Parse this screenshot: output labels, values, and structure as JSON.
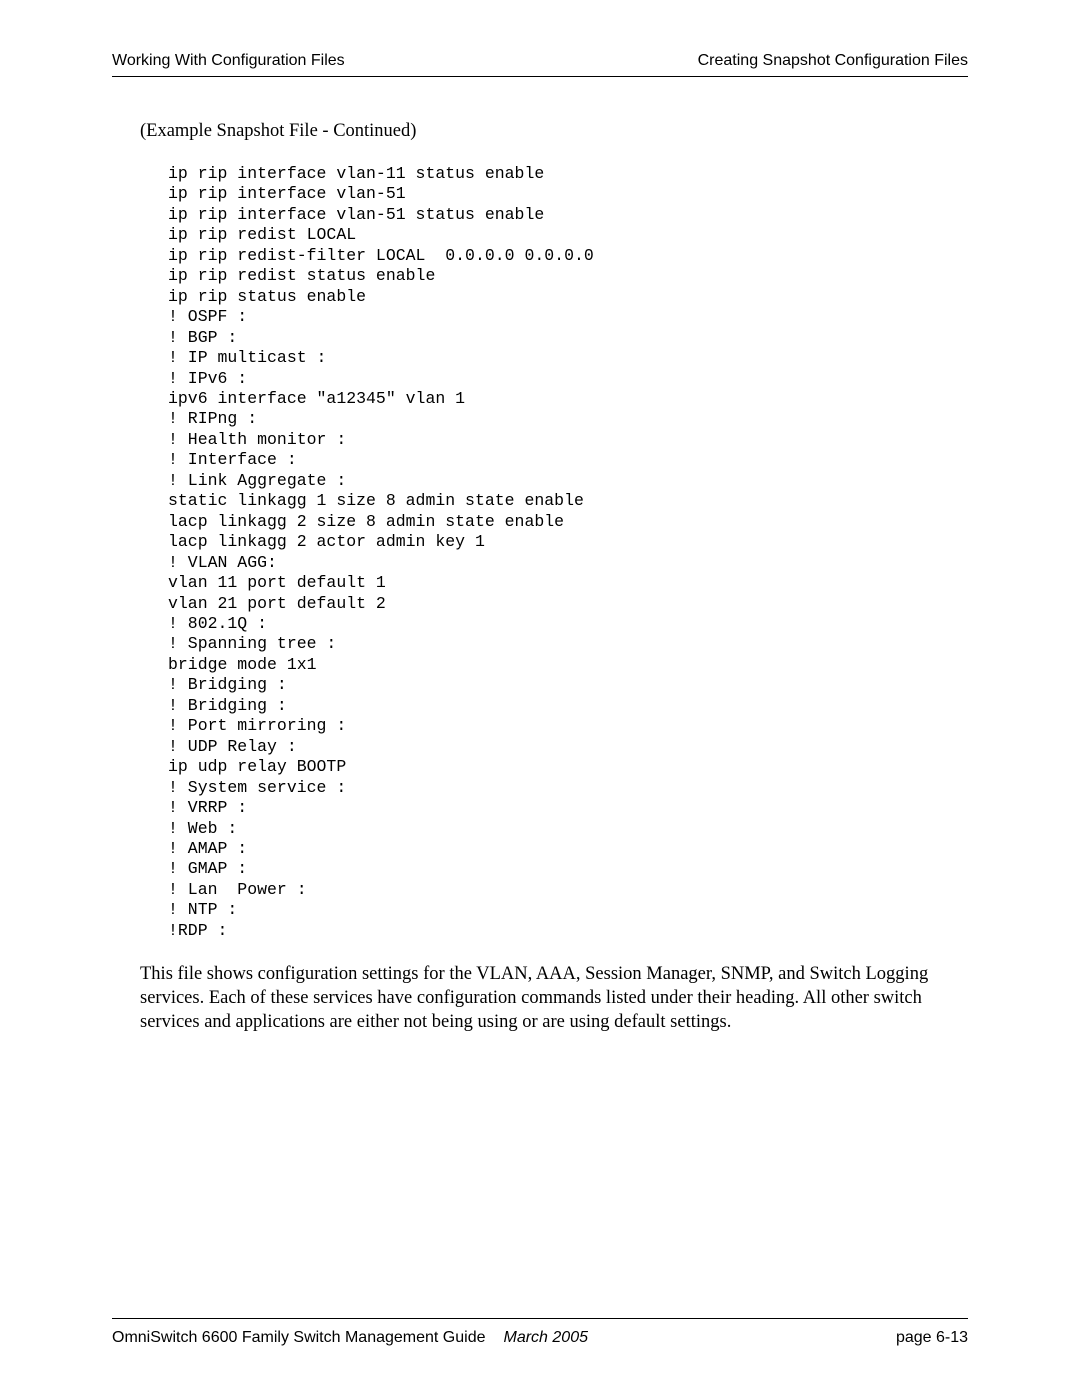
{
  "header": {
    "left": "Working With Configuration Files",
    "right": "Creating Snapshot Configuration Files"
  },
  "subtitle": "(Example Snapshot File - Continued)",
  "code": "ip rip interface vlan-11 status enable\nip rip interface vlan-51\nip rip interface vlan-51 status enable\nip rip redist LOCAL\nip rip redist-filter LOCAL  0.0.0.0 0.0.0.0\nip rip redist status enable\nip rip status enable\n! OSPF :\n! BGP :\n! IP multicast :\n! IPv6 :\nipv6 interface \"a12345\" vlan 1\n! RIPng :\n! Health monitor :\n! Interface :\n! Link Aggregate :\nstatic linkagg 1 size 8 admin state enable\nlacp linkagg 2 size 8 admin state enable\nlacp linkagg 2 actor admin key 1\n! VLAN AGG:\nvlan 11 port default 1\nvlan 21 port default 2\n! 802.1Q :\n! Spanning tree :\nbridge mode 1x1\n! Bridging :\n! Bridging :\n! Port mirroring :\n! UDP Relay :\nip udp relay BOOTP\n! System service :\n! VRRP :\n! Web :\n! AMAP :\n! GMAP :\n! Lan  Power :\n! NTP :\n!RDP :",
  "body": "This file shows configuration settings for the VLAN, AAA, Session Manager, SNMP, and Switch Logging services. Each of these services have configuration commands listed under their heading. All other switch services and applications are either not being using or are using default settings.",
  "footer": {
    "title": "OmniSwitch 6600 Family Switch Management Guide",
    "date": "March 2005",
    "page": "page 6-13"
  }
}
